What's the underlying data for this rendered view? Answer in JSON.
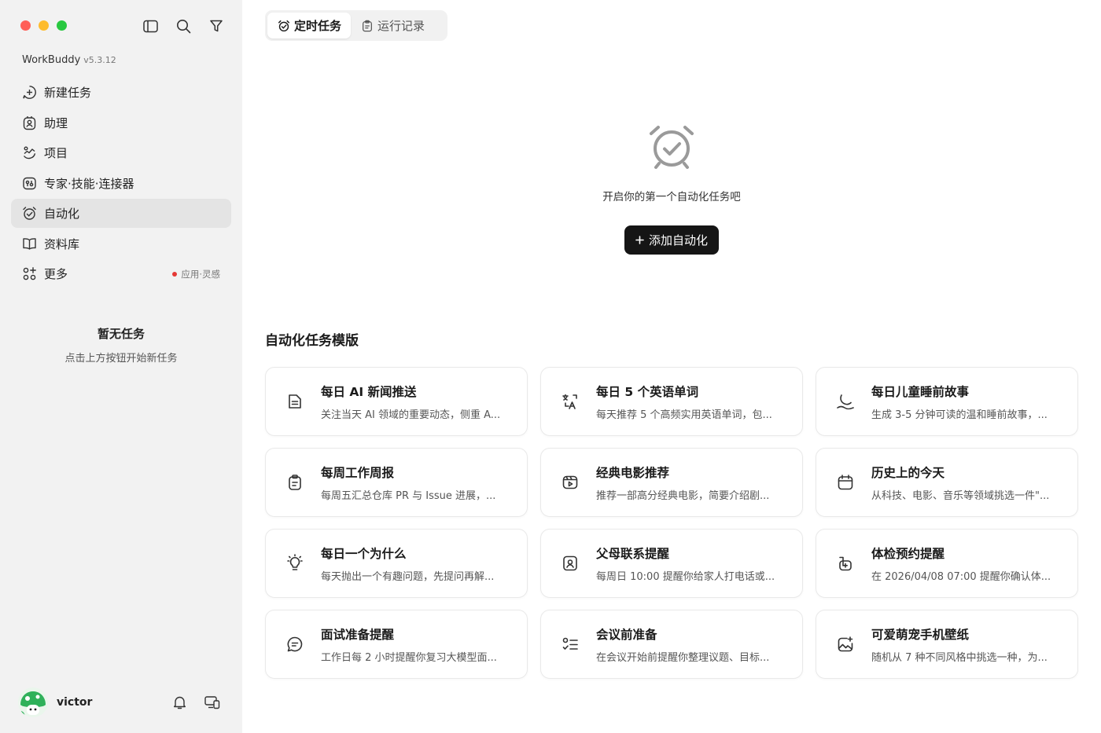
{
  "window": {
    "app_name": "WorkBuddy",
    "version": "v5.3.12"
  },
  "sidebar": {
    "items": [
      {
        "label": "新建任务",
        "icon": "new-task-icon"
      },
      {
        "label": "助理",
        "icon": "assistant-icon"
      },
      {
        "label": "项目",
        "icon": "project-icon"
      },
      {
        "label": "专家·技能·连接器",
        "icon": "expert-skills-icon"
      },
      {
        "label": "自动化",
        "icon": "alarm-clock-icon",
        "active": true
      },
      {
        "label": "资料库",
        "icon": "book-icon"
      },
      {
        "label": "更多",
        "icon": "apps-icon",
        "extra": "应用·灵感"
      }
    ],
    "empty_title": "暂无任务",
    "empty_desc": "点击上方按钮开始新任务"
  },
  "user": {
    "name": "victor"
  },
  "tabs": [
    {
      "label": "定时任务",
      "active": true
    },
    {
      "label": "运行记录",
      "active": false
    }
  ],
  "hero": {
    "message": "开启你的第一个自动化任务吧",
    "button_label": "添加自动化"
  },
  "templates": {
    "title": "自动化任务模版",
    "items": [
      {
        "title": "每日 AI 新闻推送",
        "desc": "关注当天 AI 领域的重要动态，侧重 A...",
        "icon": "news-icon"
      },
      {
        "title": "每日 5 个英语单词",
        "desc": "每天推荐 5 个高频实用英语单词，包...",
        "icon": "translate-icon"
      },
      {
        "title": "每日儿童睡前故事",
        "desc": "生成 3-5 分钟可读的温和睡前故事，...",
        "icon": "moon-icon"
      },
      {
        "title": "每周工作周报",
        "desc": "每周五汇总仓库 PR 与 Issue 进展，...",
        "icon": "clipboard-icon"
      },
      {
        "title": "经典电影推荐",
        "desc": "推荐一部高分经典电影，简要介绍剧...",
        "icon": "film-icon"
      },
      {
        "title": "历史上的今天",
        "desc": "从科技、电影、音乐等领域挑选一件\"...",
        "icon": "calendar-icon"
      },
      {
        "title": "每日一个为什么",
        "desc": "每天抛出一个有趣问题，先提问再解...",
        "icon": "lightbulb-icon"
      },
      {
        "title": "父母联系提醒",
        "desc": "每周日 10:00 提醒你给家人打电话或...",
        "icon": "contact-card-icon"
      },
      {
        "title": "体检预约提醒",
        "desc": "在 2026/04/08 07:00 提醒你确认体...",
        "icon": "medical-icon"
      },
      {
        "title": "面试准备提醒",
        "desc": "工作日每 2 小时提醒你复习大模型面...",
        "icon": "chat-bubble-icon"
      },
      {
        "title": "会议前准备",
        "desc": "在会议开始前提醒你整理议题、目标...",
        "icon": "checklist-icon"
      },
      {
        "title": "可爱萌宠手机壁纸",
        "desc": "随机从 7 种不同风格中挑选一种，为...",
        "icon": "image-add-icon"
      }
    ]
  },
  "colors": {
    "sidebar_bg": "#f2f2f2",
    "active_item_bg": "#e4e4e4",
    "primary_button": "#151515",
    "badge_dot": "#e53935",
    "traffic_red": "#ff5f57",
    "traffic_yellow": "#febc2e",
    "traffic_green": "#28c840"
  }
}
